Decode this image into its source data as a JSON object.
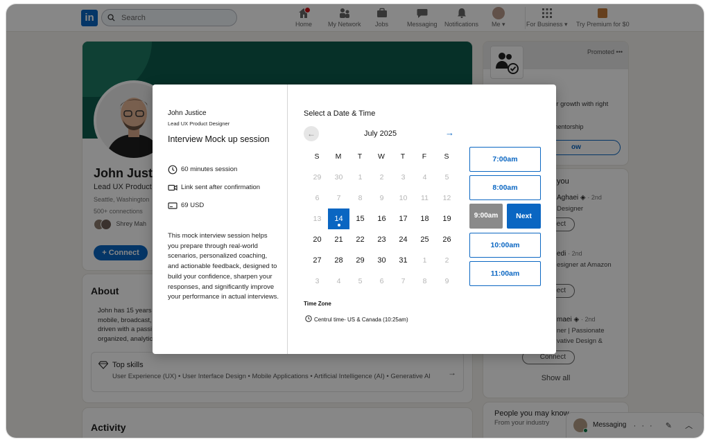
{
  "topnav": {
    "logo": "in",
    "search_placeholder": "Search",
    "items": [
      {
        "label": "Home",
        "icon": "home-icon"
      },
      {
        "label": "My Network",
        "icon": "network-icon"
      },
      {
        "label": "Jobs",
        "icon": "briefcase-icon"
      },
      {
        "label": "Messaging",
        "icon": "chat-icon"
      },
      {
        "label": "Notifications",
        "icon": "bell-icon"
      },
      {
        "label": "Me ▾",
        "icon": "avatar"
      },
      {
        "label": "For Business ▾",
        "icon": "grid-icon"
      },
      {
        "label": "Try Premium for $0",
        "icon": "premium-icon"
      }
    ]
  },
  "profile": {
    "name": "John Justic",
    "title": "Lead UX Product",
    "location": "Seattle, Washington",
    "connections": "500+ connections",
    "mutual": "Shrey Mah",
    "connect_label": "Connect"
  },
  "about": {
    "heading": "About",
    "text": "John has 15 years\nmobile, broadcast,\ndriven with a passi\norganized, analytic",
    "skills_heading": "Top skills",
    "skills_text": "User Experience (UX) • User Interface Design • Mobile Applications • Artificial Intelligence (AI) • Generative AI",
    "arrow": "→"
  },
  "activity": {
    "heading": "Activity"
  },
  "right_promo": {
    "promoted": "Promoted",
    "dots": "•••",
    "line1": "er growth with right",
    "line2": "mentorship",
    "button": "ow"
  },
  "people": {
    "heading": "you",
    "list": [
      {
        "name": "Aghaei",
        "degree": "· 2nd",
        "sub": "Designer",
        "button": "ect"
      },
      {
        "name": "edi",
        "degree": "· 2nd",
        "sub": "esigner at Amazon",
        "button": "ect"
      },
      {
        "name": "maei",
        "degree": "· 2nd",
        "sub": "ner | Passionate",
        "sub2": "vative Design &",
        "button": "Connect"
      }
    ],
    "show_all": "Show all"
  },
  "people_know": {
    "heading": "People you may know",
    "sub": "From your industry"
  },
  "messaging": {
    "label": "Messaging",
    "icons": "··· ✎ ︿"
  },
  "modal": {
    "host_name": "John Justice",
    "host_role": "Lead UX Product Designer",
    "session_title": "Interview Mock up session",
    "duration": "60 minutes session",
    "link_info": "Link sent after confirmation",
    "price": "69 USD",
    "description": "This mock interview session helps you prepare through real-world scenarios, personalized coaching, and actionable feedback, designed to build your confidence, sharpen your responses, and significantly improve your performance in actual interviews.",
    "select_title": "Select a Date & Time",
    "prev": "←",
    "next_month": "→",
    "month": "July 2025",
    "weekdays": [
      "S",
      "M",
      "T",
      "W",
      "T",
      "F",
      "S"
    ],
    "weeks": [
      [
        "29",
        "30",
        "1",
        "2",
        "3",
        "4",
        "5"
      ],
      [
        "6",
        "7",
        "8",
        "9",
        "10",
        "11",
        "12"
      ],
      [
        "13",
        "14",
        "15",
        "16",
        "17",
        "18",
        "19"
      ],
      [
        "20",
        "21",
        "22",
        "23",
        "24",
        "25",
        "26"
      ],
      [
        "27",
        "28",
        "29",
        "30",
        "31",
        "1",
        "2"
      ],
      [
        "3",
        "4",
        "5",
        "6",
        "7",
        "8",
        "9"
      ]
    ],
    "selected_day": "14",
    "timezone_label": "Time Zone",
    "timezone_value": "Centrul time- US & Canada (10:25am)",
    "slots": [
      "7:00am",
      "8:00am",
      "10:00am",
      "11:00am"
    ],
    "selected_slot": "9:00am",
    "next_button": "Next"
  }
}
